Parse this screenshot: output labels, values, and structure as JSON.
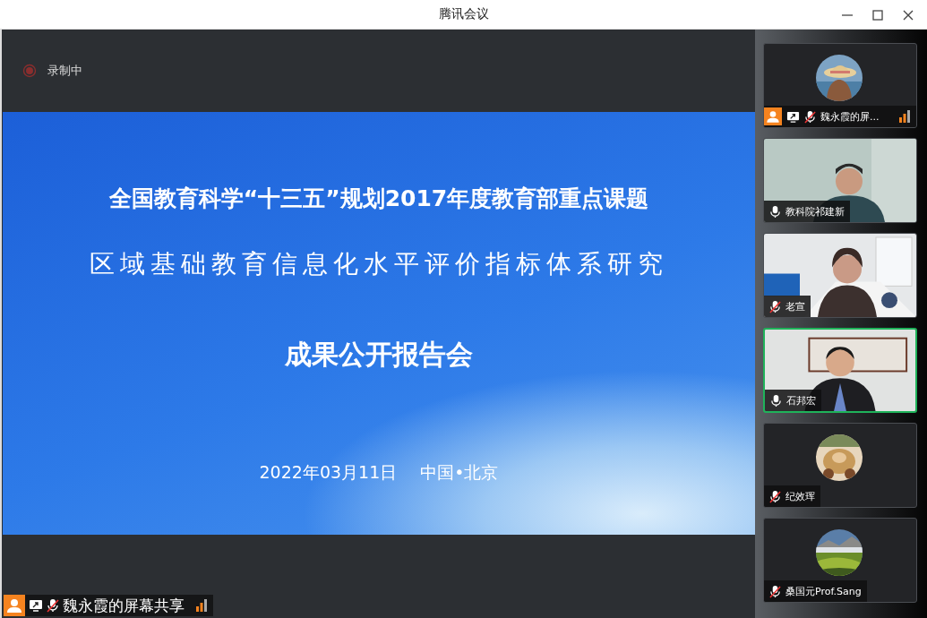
{
  "window": {
    "title": "腾讯会议"
  },
  "recording": {
    "label": "录制中"
  },
  "slide": {
    "title": "全国教育科学“十三五”规划2017年度教育部重点课题",
    "subtitle": "区域基础教育信息化水平评价指标体系研究",
    "heading": "成果公开报告会",
    "date": "2022年03月11日",
    "place": "中国•北京"
  },
  "share_bar": {
    "label": "魏永霞的屏幕共享",
    "host": true,
    "sharing": true,
    "muted": true
  },
  "participants": [
    {
      "name": "魏永霞的屏...",
      "kind": "avatar",
      "host": true,
      "sharing": true,
      "muted": true,
      "speaking": false
    },
    {
      "name": "教科院祁建新",
      "kind": "video",
      "host": false,
      "sharing": false,
      "muted": false,
      "speaking": false
    },
    {
      "name": "老宣",
      "kind": "video",
      "host": false,
      "sharing": false,
      "muted": true,
      "speaking": false
    },
    {
      "name": "石邦宏",
      "kind": "video",
      "host": false,
      "sharing": false,
      "muted": false,
      "speaking": true
    },
    {
      "name": "纪效珲",
      "kind": "avatar",
      "host": false,
      "sharing": false,
      "muted": true,
      "speaking": false
    },
    {
      "name": "桑国元Prof.Sang",
      "kind": "avatar",
      "host": false,
      "sharing": false,
      "muted": true,
      "speaking": false
    }
  ]
}
